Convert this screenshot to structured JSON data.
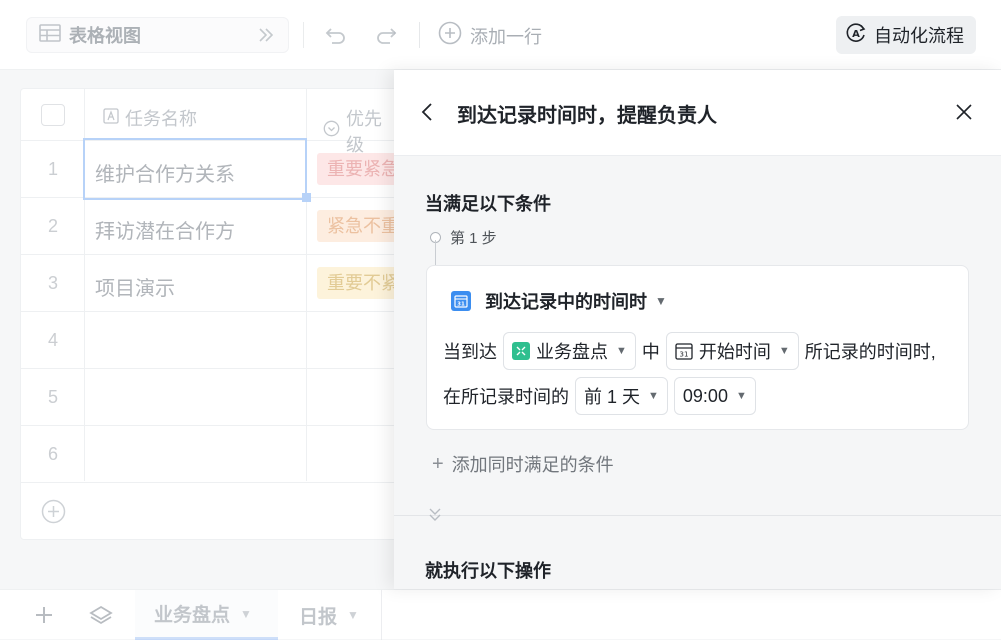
{
  "toolbar": {
    "view_label": "表格视图",
    "add_row_label": "添加一行",
    "automation_label": "自动化流程"
  },
  "grid": {
    "columns": [
      {
        "label": "任务名称"
      },
      {
        "label": "优先级"
      }
    ],
    "rows": [
      {
        "num": "1",
        "name": "维护合作方关系",
        "tag": "重要紧急",
        "tag_bg": "#fde2e2",
        "tag_fg": "#e8a3a3"
      },
      {
        "num": "2",
        "name": "拜访潜在合作方",
        "tag": "紧急不重要",
        "tag_bg": "#fde9d9",
        "tag_fg": "#e8b48c"
      },
      {
        "num": "3",
        "name": "项目演示",
        "tag": "重要不紧急",
        "tag_bg": "#fdf1d3",
        "tag_fg": "#dcc07e"
      },
      {
        "num": "4",
        "name": ""
      },
      {
        "num": "5",
        "name": ""
      },
      {
        "num": "6",
        "name": ""
      }
    ]
  },
  "sheets": [
    {
      "label": "业务盘点",
      "active": true
    },
    {
      "label": "日报",
      "active": false
    }
  ],
  "drawer": {
    "title": "到达记录时间时，提醒负责人",
    "condition_title": "当满足以下条件",
    "step_label": "第 1 步",
    "trigger_label": "到达记录中的时间时",
    "line1_prefix": "当到达",
    "table_pill": "业务盘点",
    "middle_word": "中",
    "field_pill": "开始时间",
    "line1_suffix": "所记录的时间时,",
    "line2_prefix": "在所记录时间的",
    "offset_pill": "前 1 天",
    "time_pill": "09:00",
    "add_condition_label": "添加同时满足的条件",
    "action_title": "就执行以下操作"
  },
  "colors": {
    "accent_blue": "#3c8ef0",
    "table_icon_green": "#2fbf8f"
  }
}
